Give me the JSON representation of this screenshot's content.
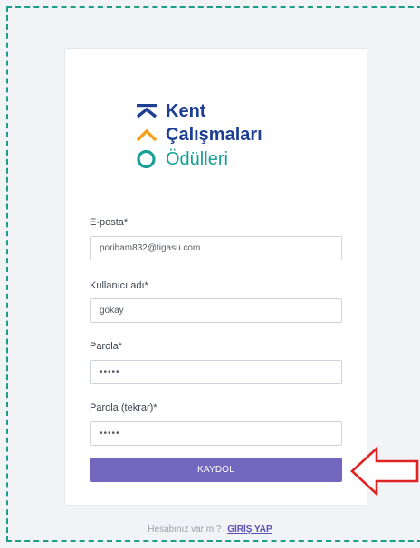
{
  "logo": {
    "line1": "Kent",
    "line2": "Çalışmaları",
    "line3": "Ödülleri"
  },
  "form": {
    "email": {
      "label": "E-posta*",
      "value": "poriham832@tigasu.com"
    },
    "username": {
      "label": "Kullanıcı adı*",
      "value": "gökay"
    },
    "password": {
      "label": "Parola*",
      "value": "•••••"
    },
    "password_confirm": {
      "label": "Parola (tekrar)*",
      "value": "•••••"
    },
    "submit_label": "KAYDOL"
  },
  "footer": {
    "question": "Hesabınız var mı?",
    "login_link": "GİRİŞ YAP"
  },
  "colors": {
    "accent": "#7366bf",
    "brand_blue": "#1d3f92",
    "brand_teal": "#17a097",
    "brand_orange": "#f4a21e",
    "annotation_red": "#e02222",
    "dashed_border": "#1a9e86"
  },
  "icons": [
    "kent-logo-icon",
    "red-arrow-icon"
  ]
}
